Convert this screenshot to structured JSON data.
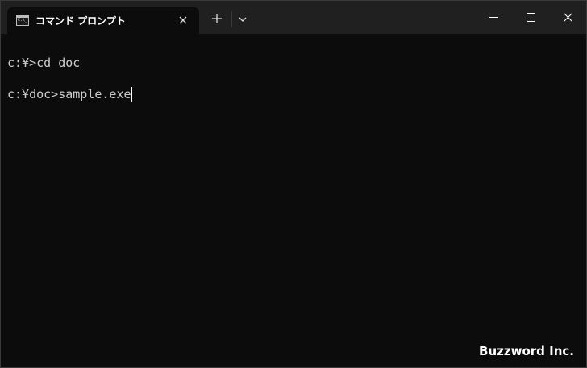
{
  "window": {
    "tab_title": "コマンド プロンプト",
    "icons": {
      "tab": "cmd-prompt-icon",
      "tab_close": "close-icon",
      "new_tab": "plus-icon",
      "dropdown": "chevron-down-icon",
      "minimize": "minimize-icon",
      "maximize": "maximize-icon",
      "close": "close-icon"
    }
  },
  "terminal": {
    "lines": [
      "c:¥>cd doc",
      "c:¥doc>sample.exe"
    ]
  },
  "watermark": "Buzzword Inc.",
  "colors": {
    "titlebar": "#202020",
    "background": "#0c0c0c",
    "text": "#cccccc"
  }
}
